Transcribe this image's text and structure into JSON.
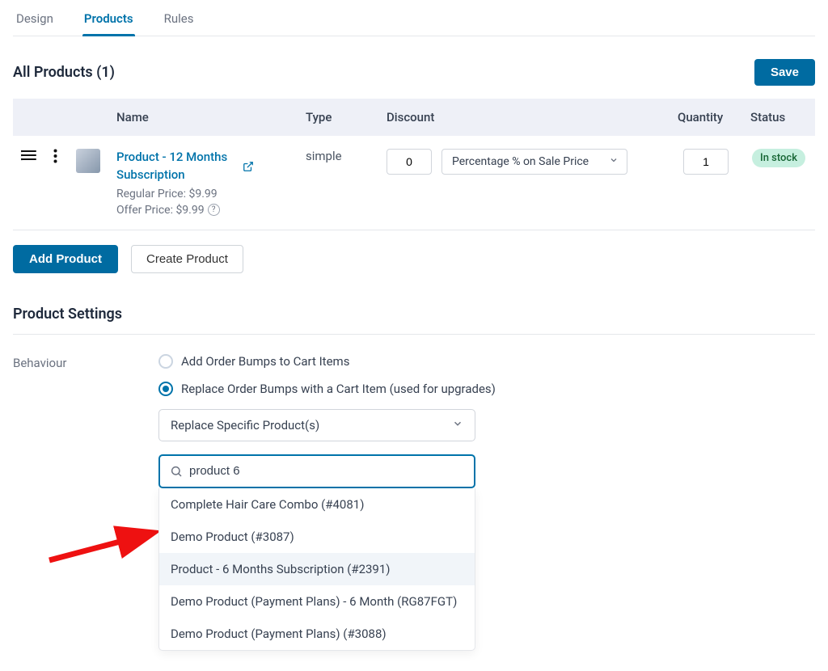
{
  "tabs": {
    "design": "Design",
    "products": "Products",
    "rules": "Rules"
  },
  "allProducts": {
    "heading": "All Products (1)",
    "save": "Save"
  },
  "tableHead": {
    "name": "Name",
    "type": "Type",
    "discount": "Discount",
    "quantity": "Quantity",
    "status": "Status"
  },
  "row": {
    "name": "Product - 12 Months Subscription",
    "regular": "Regular Price: $9.99",
    "offer": "Offer Price: $9.99",
    "type": "simple",
    "discountValue": "0",
    "discountType": "Percentage % on Sale Price",
    "qty": "1",
    "status": "In stock"
  },
  "buttons": {
    "addProduct": "Add Product",
    "createProduct": "Create Product"
  },
  "settings": {
    "title": "Product Settings",
    "behaviourLabel": "Behaviour",
    "opt1": "Add Order Bumps to Cart Items",
    "opt2": "Replace Order Bumps with a Cart Item (used for upgrades)",
    "replaceSelect": "Replace Specific Product(s)",
    "searchValue": "product 6",
    "results": [
      "Complete Hair Care Combo (#4081)",
      "Demo Product (#3087)",
      "Product - 6 Months Subscription (#2391)",
      "Demo Product (Payment Plans) - 6 Month (RG87FGT)",
      "Demo Product (Payment Plans) (#3088)"
    ]
  }
}
